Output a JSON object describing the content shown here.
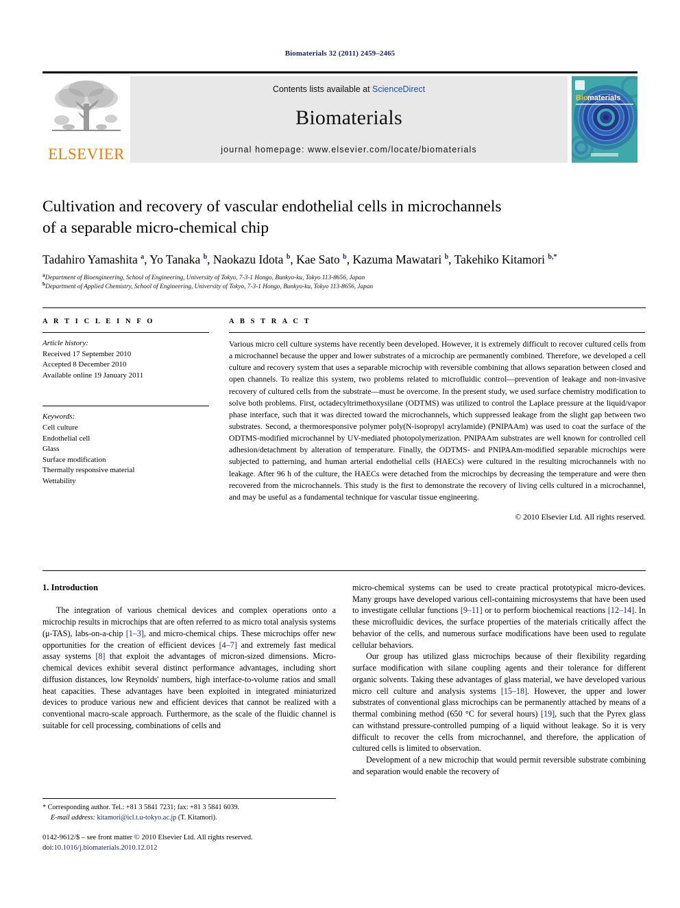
{
  "running_head": "Biomaterials 32 (2011) 2459–2465",
  "masthead": {
    "publisher": "ELSEVIER",
    "contents_prefix": "Contents lists available at ",
    "contents_link": "ScienceDirect",
    "journal_name": "Biomaterials",
    "homepage": "journal homepage: www.elsevier.com/locate/biomaterials",
    "cover_title_a": "Bio",
    "cover_title_b": "materials"
  },
  "article": {
    "title_line1": "Cultivation and recovery of vascular endothelial cells in microchannels",
    "title_line2": "of a separable micro-chemical chip",
    "authors": "Tadahiro Yamashita a, Yo Tanaka b, Naokazu Idota b, Kae Sato b, Kazuma Mawatari b, Takehiko Kitamori b,*",
    "affiliation_a": "Department of Bioengineering, School of Engineering, University of Tokyo, 7-3-1 Hongo, Bunkyo-ku, Tokyo 113-8656, Japan",
    "affiliation_b": "Department of Applied Chemistry, School of Engineering, University of Tokyo, 7-3-1 Hongo, Bunkyo-ku, Tokyo 113-8656, Japan"
  },
  "article_info": {
    "heading": "A R T I C L E  I N F O",
    "history_label": "Article history:",
    "received": "Received 17 September 2010",
    "accepted": "Accepted 8 December 2010",
    "available": "Available online 19 January 2011",
    "keywords_label": "Keywords:",
    "keywords": [
      "Cell culture",
      "Endothelial cell",
      "Glass",
      "Surface modification",
      "Thermally responsive material",
      "Wettability"
    ]
  },
  "abstract": {
    "heading": "A B S T R A C T",
    "text": "Various micro cell culture systems have recently been developed. However, it is extremely difficult to recover cultured cells from a microchannel because the upper and lower substrates of a microchip are permanently combined. Therefore, we developed a cell culture and recovery system that uses a separable microchip with reversible combining that allows separation between closed and open channels. To realize this system, two problems related to microfluidic control—prevention of leakage and non-invasive recovery of cultured cells from the substrate—must be overcome. In the present study, we used surface chemistry modification to solve both problems. First, octadecyltrimethoxysilane (ODTMS) was utilized to control the Laplace pressure at the liquid/vapor phase interface, such that it was directed toward the microchannels, which suppressed leakage from the slight gap between two substrates. Second, a thermoresponsive polymer poly(N-isopropyl acrylamide) (PNIPAAm) was used to coat the surface of the ODTMS-modified microchannel by UV-mediated photopolymerization. PNIPAAm substrates are well known for controlled cell adhesion/detachment by alteration of temperature. Finally, the ODTMS- and PNIPAAm-modified separable microchips were subjected to patterning, and human arterial endothelial cells (HAECs) were cultured in the resulting microchannels with no leakage. After 96 h of the culture, the HAECs were detached from the microchips by decreasing the temperature and were then recovered from the microchannels. This study is the first to demonstrate the recovery of living cells cultured in a microchannel, and may be useful as a fundamental technique for vascular tissue engineering.",
    "copyright": "© 2010 Elsevier Ltd. All rights reserved."
  },
  "introduction": {
    "heading": "1. Introduction",
    "left_p1_a": "The integration of various chemical devices and complex operations onto a microchip results in microchips that are often referred to as micro total analysis systems (μ-TAS), labs-on-a-chip ",
    "left_p1_ref1": "[1–3]",
    "left_p1_b": ", and micro-chemical chips. These microchips offer new opportunities for the creation of efficient devices ",
    "left_p1_ref2": "[4–7]",
    "left_p1_c": " and extremely fast medical assay systems ",
    "left_p1_ref3": "[8]",
    "left_p1_d": " that exploit the advantages of micron-sized dimensions. Micro-chemical devices exhibit several distinct performance advantages, including short diffusion distances, low Reynolds' numbers, high interface-to-volume ratios and small heat capacities. These advantages have been exploited in integrated miniaturized devices to produce various new and efficient devices that cannot be realized with a conventional macro-scale approach. Furthermore, as the scale of the fluidic channel is suitable for cell processing, combinations of cells and",
    "right_p1_a": "micro-chemical systems can be used to create practical prototypical micro-devices. Many groups have developed various cell-containing microsystems that have been used to investigate cellular functions ",
    "right_p1_ref1": "[9–11]",
    "right_p1_b": " or to perform biochemical reactions ",
    "right_p1_ref2": "[12–14]",
    "right_p1_c": ". In these microfluidic devices, the surface properties of the materials critically affect the behavior of the cells, and numerous surface modifications have been used to regulate cellular behaviors.",
    "right_p2_a": "Our group has utilized glass microchips because of their flexibility regarding surface modification with silane coupling agents and their tolerance for different organic solvents. Taking these advantages of glass material, we have developed various micro cell culture and analysis systems ",
    "right_p2_ref1": "[15–18]",
    "right_p2_b": ". However, the upper and lower substrates of conventional glass microchips can be permanently attached by means of a thermal combining method (650 °C for several hours) ",
    "right_p2_ref2": "[19]",
    "right_p2_c": ", such that the Pyrex glass can withstand pressure-controlled pumping of a liquid without leakage. So it is very difficult to recover the cells from microchannel, and therefore, the application of cultured cells is limited to observation.",
    "right_p3": "Development of a new microchip that would permit reversible substrate combining and separation would enable the recovery of"
  },
  "footnote": {
    "line1": "* Corresponding author. Tel.: +81 3 5841 7231; fax: +81 3 5841 6039.",
    "email_label": "E-mail address:",
    "email": "kitamori@icl.t.u-tokyo.ac.jp",
    "email_suffix": " (T. Kitamori)."
  },
  "legal": {
    "line1": "0142-9612/$ – see front matter © 2010 Elsevier Ltd. All rights reserved.",
    "doi_label": "doi:",
    "doi": "10.1016/j.biomaterials.2010.12.012"
  },
  "colors": {
    "link_blue": "#16226b",
    "sciencedirect_blue": "#1a4fa0",
    "elsevier_orange": "#f07d00",
    "masthead_gray": "#e8e8e8",
    "cover_teal": "#3fa8a8",
    "cover_blue": "#2a3f9e"
  }
}
